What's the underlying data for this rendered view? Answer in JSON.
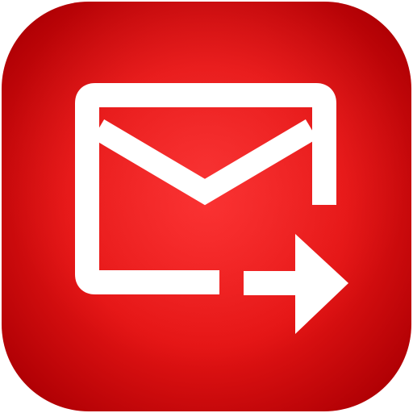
{
  "icon": {
    "semantic": "mail-forward-icon",
    "background_inner": "#f82828",
    "background_mid": "#e41414",
    "background_outer": "#b00004",
    "glyph_color": "#ffffff"
  }
}
